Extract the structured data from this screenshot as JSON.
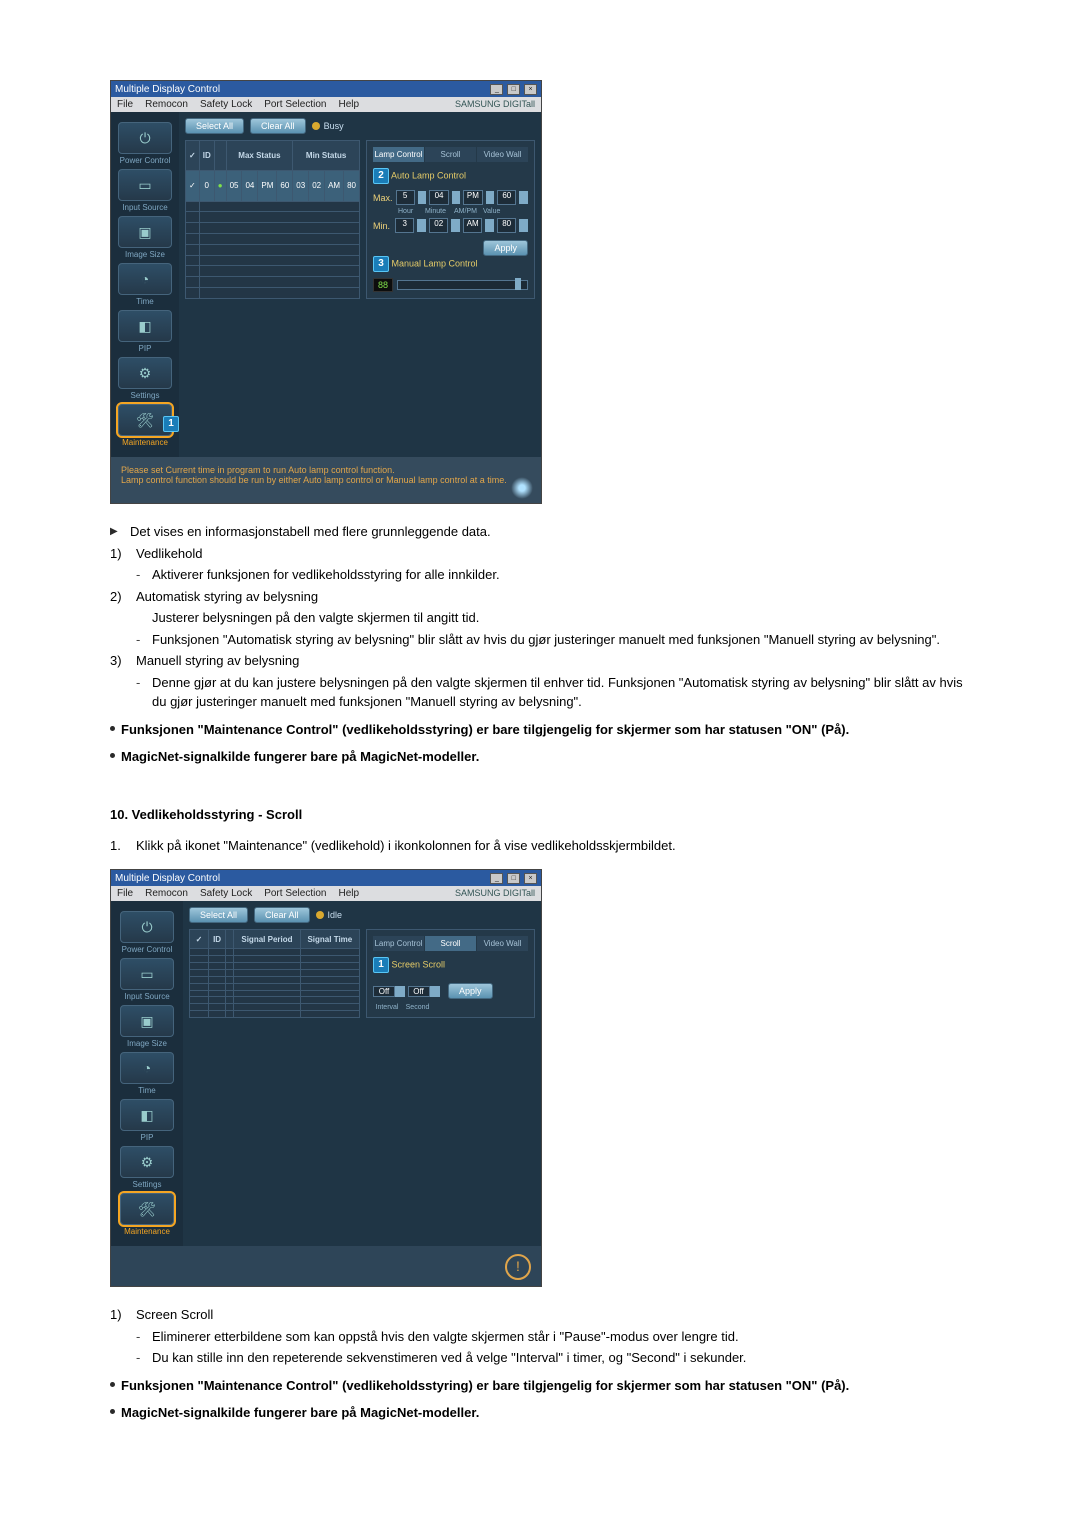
{
  "app_title": "Multiple Display Control",
  "menu": {
    "file": "File",
    "remocon": "Remocon",
    "safety": "Safety Lock",
    "port": "Port Selection",
    "help": "Help",
    "brand": "SAMSUNG DIGITall"
  },
  "sidebar": {
    "power": "Power Control",
    "input": "Input Source",
    "image": "Image Size",
    "time": "Time",
    "pip": "PIP",
    "settings": "Settings",
    "maint": "Maintenance"
  },
  "topbuttons": {
    "select_all": "Select All",
    "clear_all": "Clear All",
    "busy": "Busy",
    "idle": "Idle"
  },
  "markers": {
    "m1": "1",
    "m2": "2",
    "m3": "3"
  },
  "lamp_table": {
    "cols": {
      "chk": "✓",
      "id": "ID",
      "fl": "",
      "max": "Max Status",
      "min": "Min Status"
    },
    "row": {
      "id": "0",
      "fl": "●",
      "h1": "05",
      "m1": "04",
      "ap1": "PM",
      "v1": "60",
      "h2": "03",
      "m2": "02",
      "ap2": "AM",
      "v2": "80"
    }
  },
  "panel": {
    "tabs": {
      "lamp": "Lamp Control",
      "scroll": "Scroll",
      "video": "Video Wall"
    },
    "auto": "Auto Lamp Control",
    "max": "Max.",
    "min": "Min.",
    "max_vals": {
      "h": "5",
      "m": "04",
      "ap": "PM",
      "v": "60"
    },
    "min_vals": {
      "h": "3",
      "m": "02",
      "ap": "AM",
      "v": "80"
    },
    "caps": {
      "hour": "Hour",
      "minute": "Minute",
      "ampm": "AM/PM",
      "value": "Value"
    },
    "apply": "Apply",
    "manual": "Manual Lamp Control",
    "manual_val": "88"
  },
  "footer1": {
    "line1": "Please set Current time in program to run Auto lamp control function.",
    "line2": "Lamp control function should be run by either Auto lamp control or Manual lamp control at a time."
  },
  "scroll_table": {
    "cols": {
      "chk": "✓",
      "id": "ID",
      "fl": "",
      "period": "Signal Period",
      "time": "Signal Time"
    }
  },
  "scroll_panel": {
    "title": "Screen Scroll",
    "interval": "Interval",
    "second": "Second",
    "off1": "Off",
    "off2": "Off",
    "apply": "Apply"
  },
  "doc": {
    "intro": "Det vises en informasjonstabell med flere grunnleggende data.",
    "p1_label": "1)",
    "p1_title": "Vedlikehold",
    "p1_sub1": "Aktiverer funksjonen for vedlikeholdsstyring for alle innkilder.",
    "p2_label": "2)",
    "p2_title": "Automatisk styring av belysning",
    "p2_sub1": "Justerer belysningen på den valgte skjermen til angitt tid.",
    "p2_sub2": "Funksjonen \"Automatisk styring av belysning\" blir slått av hvis du gjør justeringer manuelt med funksjonen \"Manuell styring av belysning\".",
    "p3_label": "3)",
    "p3_title": "Manuell styring av belysning",
    "p3_sub1": "Denne gjør at du kan justere belysningen på den valgte skjermen til enhver tid. Funksjonen \"Automatisk styring av belysning\" blir slått av hvis du gjør justeringer manuelt med funksjonen \"Manuell styring av belysning\".",
    "note1": "Funksjonen \"Maintenance Control\" (vedlikeholdsstyring) er bare tilgjengelig for skjermer som har statusen \"ON\" (På).",
    "note2": "MagicNet-signalkilde fungerer bare på MagicNet-modeller.",
    "section2_title": "10. Vedlikeholdsstyring - Scroll",
    "section2_num": "1.",
    "section2_intro": "Klikk på ikonet \"Maintenance\" (vedlikehold) i ikonkolonnen for å vise vedlikeholdsskjermbildet.",
    "s1_label": "1)",
    "s1_title": "Screen Scroll",
    "s1_sub1": "Eliminerer etterbildene som kan oppstå hvis den valgte skjermen står i \"Pause\"-modus over lengre tid.",
    "s1_sub2": "Du kan stille inn den repeterende sekvenstimeren ved å velge \"Interval\" i timer, og \"Second\" i sekunder.",
    "note3": "Funksjonen \"Maintenance Control\" (vedlikeholdsstyring) er bare tilgjengelig for skjermer som har statusen \"ON\" (På).",
    "note4": "MagicNet-signalkilde fungerer bare på MagicNet-modeller."
  }
}
